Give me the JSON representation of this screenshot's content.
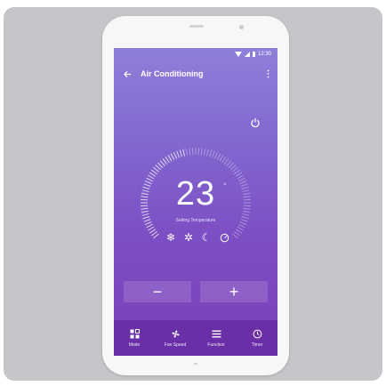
{
  "status_bar": {
    "time": "12:30",
    "icons": [
      "wifi-icon",
      "signal-icon",
      "battery-icon"
    ]
  },
  "app_bar": {
    "title": "Air Conditioning",
    "back_icon": "back-arrow-icon",
    "menu_icon": "more-vert-icon"
  },
  "power": {
    "icon": "power-icon"
  },
  "thermostat": {
    "temperature": "23",
    "unit": "°",
    "label": "Setting Temperature",
    "mode_icons": [
      "snowflake-icon",
      "fan-icon",
      "moon-icon",
      "gauge-icon"
    ]
  },
  "controls": {
    "minus_label": "−",
    "plus_label": "+"
  },
  "bottom_nav": [
    {
      "label": "Mode",
      "icon": "mode-icon"
    },
    {
      "label": "Fan Speed",
      "icon": "fan-speed-icon"
    },
    {
      "label": "Function",
      "icon": "function-icon"
    },
    {
      "label": "Timer",
      "icon": "timer-icon"
    }
  ],
  "colors": {
    "accent": "#7b4ac2",
    "nav_background": "#6a2fa6",
    "frame_background": "#c4c6c9"
  }
}
